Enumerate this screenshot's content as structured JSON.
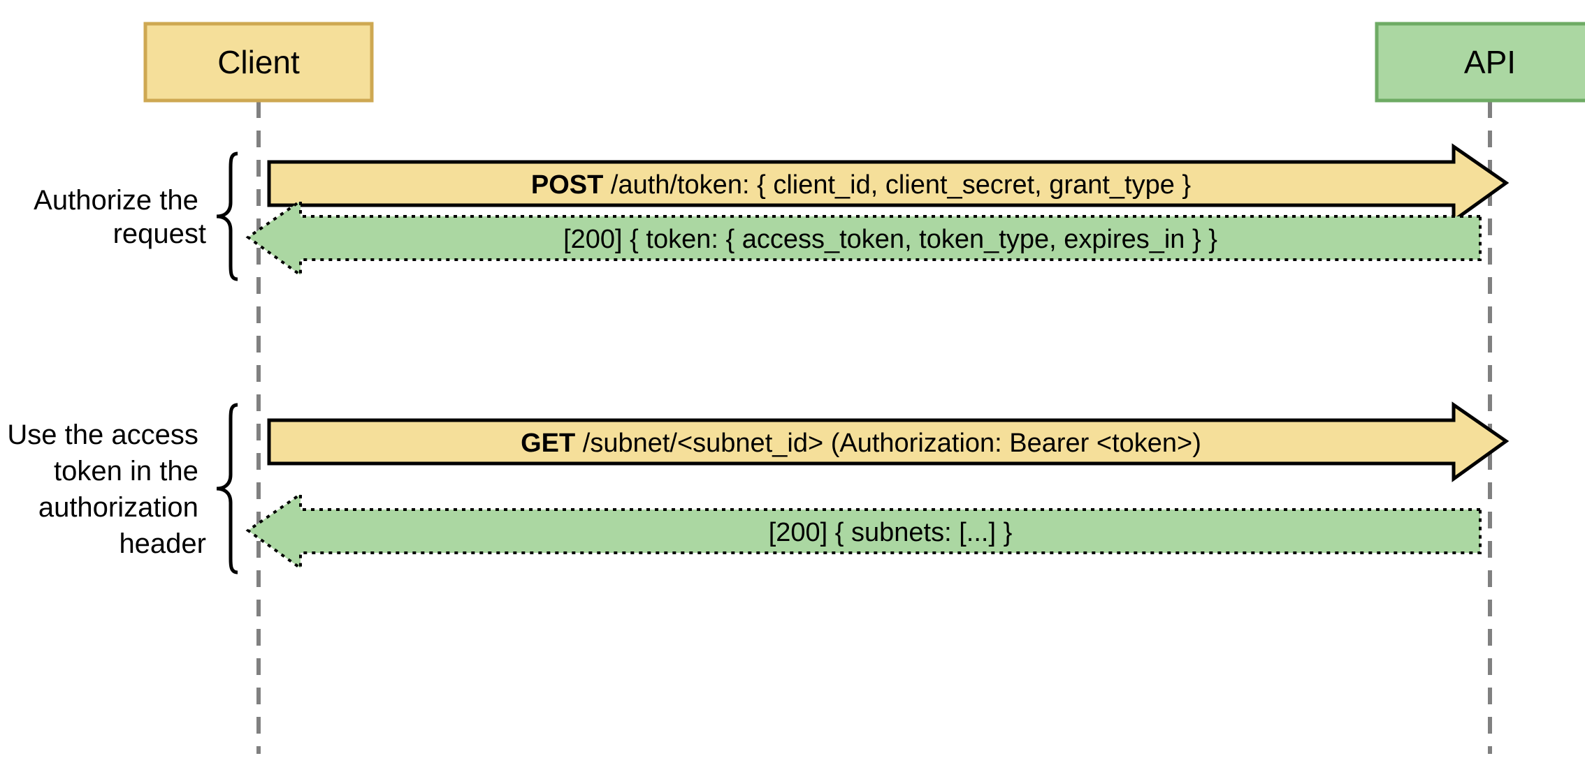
{
  "participants": {
    "client": {
      "label": "Client",
      "fill": "#f5df9a",
      "stroke": "#cea852"
    },
    "api": {
      "label": "API",
      "fill": "#abd7a2",
      "stroke": "#6eab64"
    }
  },
  "groups": [
    {
      "label_lines": [
        "Authorize the",
        "request"
      ],
      "request": {
        "method": "POST",
        "text": " /auth/token: { client_id, client_secret, grant_type }"
      },
      "response": {
        "text": "[200] { token: { access_token, token_type, expires_in } }"
      }
    },
    {
      "label_lines": [
        "Use the access",
        "token in the",
        "authorization",
        "header"
      ],
      "request": {
        "method": "GET",
        "text": " /subnet/<subnet_id> (Authorization: Bearer <token>)"
      },
      "response": {
        "text": "[200] { subnets: [...] }"
      }
    }
  ],
  "colors": {
    "client_fill": "#f5df9a",
    "client_stroke": "#000000",
    "api_fill": "#abd7a2",
    "api_stroke": "#000000",
    "lifeline": "#808080"
  },
  "chart_data": {
    "type": "sequence-diagram",
    "participants": [
      "Client",
      "API"
    ],
    "messages": [
      {
        "from": "Client",
        "to": "API",
        "kind": "request",
        "label": "POST /auth/token: { client_id, client_secret, grant_type }"
      },
      {
        "from": "API",
        "to": "Client",
        "kind": "response",
        "label": "[200] { token: { access_token, token_type, expires_in } }"
      },
      {
        "from": "Client",
        "to": "API",
        "kind": "request",
        "label": "GET /subnet/<subnet_id> (Authorization: Bearer <token>)"
      },
      {
        "from": "API",
        "to": "Client",
        "kind": "response",
        "label": "[200] { subnets: [...] }"
      }
    ],
    "annotations": [
      {
        "range": [
          0,
          1
        ],
        "text": "Authorize the request"
      },
      {
        "range": [
          2,
          3
        ],
        "text": "Use the access token in the authorization header"
      }
    ]
  }
}
